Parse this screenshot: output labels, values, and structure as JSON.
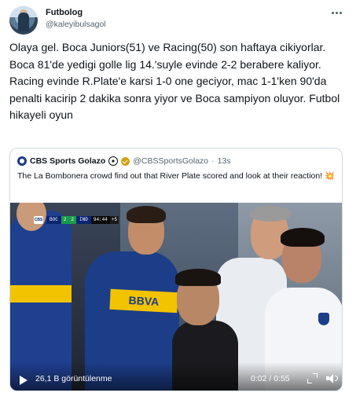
{
  "author": {
    "name": "Futbolog",
    "handle": "@kaleyibulsagol"
  },
  "tweet_text": "Olaya gel. Boca Juniors(51) ve Racing(50) son haftaya cikiyorlar. Boca 81'de yedigi golle lig 14.'suyle evinde 2-2 berabere kaliyor. Racing evinde R.Plate'e karsi 1-0 one geciyor, mac 1-1'ken 90'da penalti kacirip 2 dakika sonra yiyor ve Boca sampiyon oluyor. Futbol hikayeli oyun",
  "quoted": {
    "name": "CBS Sports Golazo",
    "handle": "@CBSSportsGolazo",
    "separator": "·",
    "time": "13s",
    "text": "The La Bombonera crowd find out that River Plate scored and look at their reaction!",
    "emoji": "💥"
  },
  "video": {
    "scoreboard": {
      "home": "BOC",
      "home_score": "2",
      "away_score": "2",
      "away": "IND",
      "clock": "94:44",
      "added": "+5"
    },
    "sponsor_text": "BBVA",
    "views": "26,1 B görüntülenme",
    "time": "0:02 / 0:55"
  },
  "icons": {
    "more": "more-dots-icon",
    "play": "play-icon",
    "expand": "expand-icon",
    "volume": "volume-icon"
  }
}
